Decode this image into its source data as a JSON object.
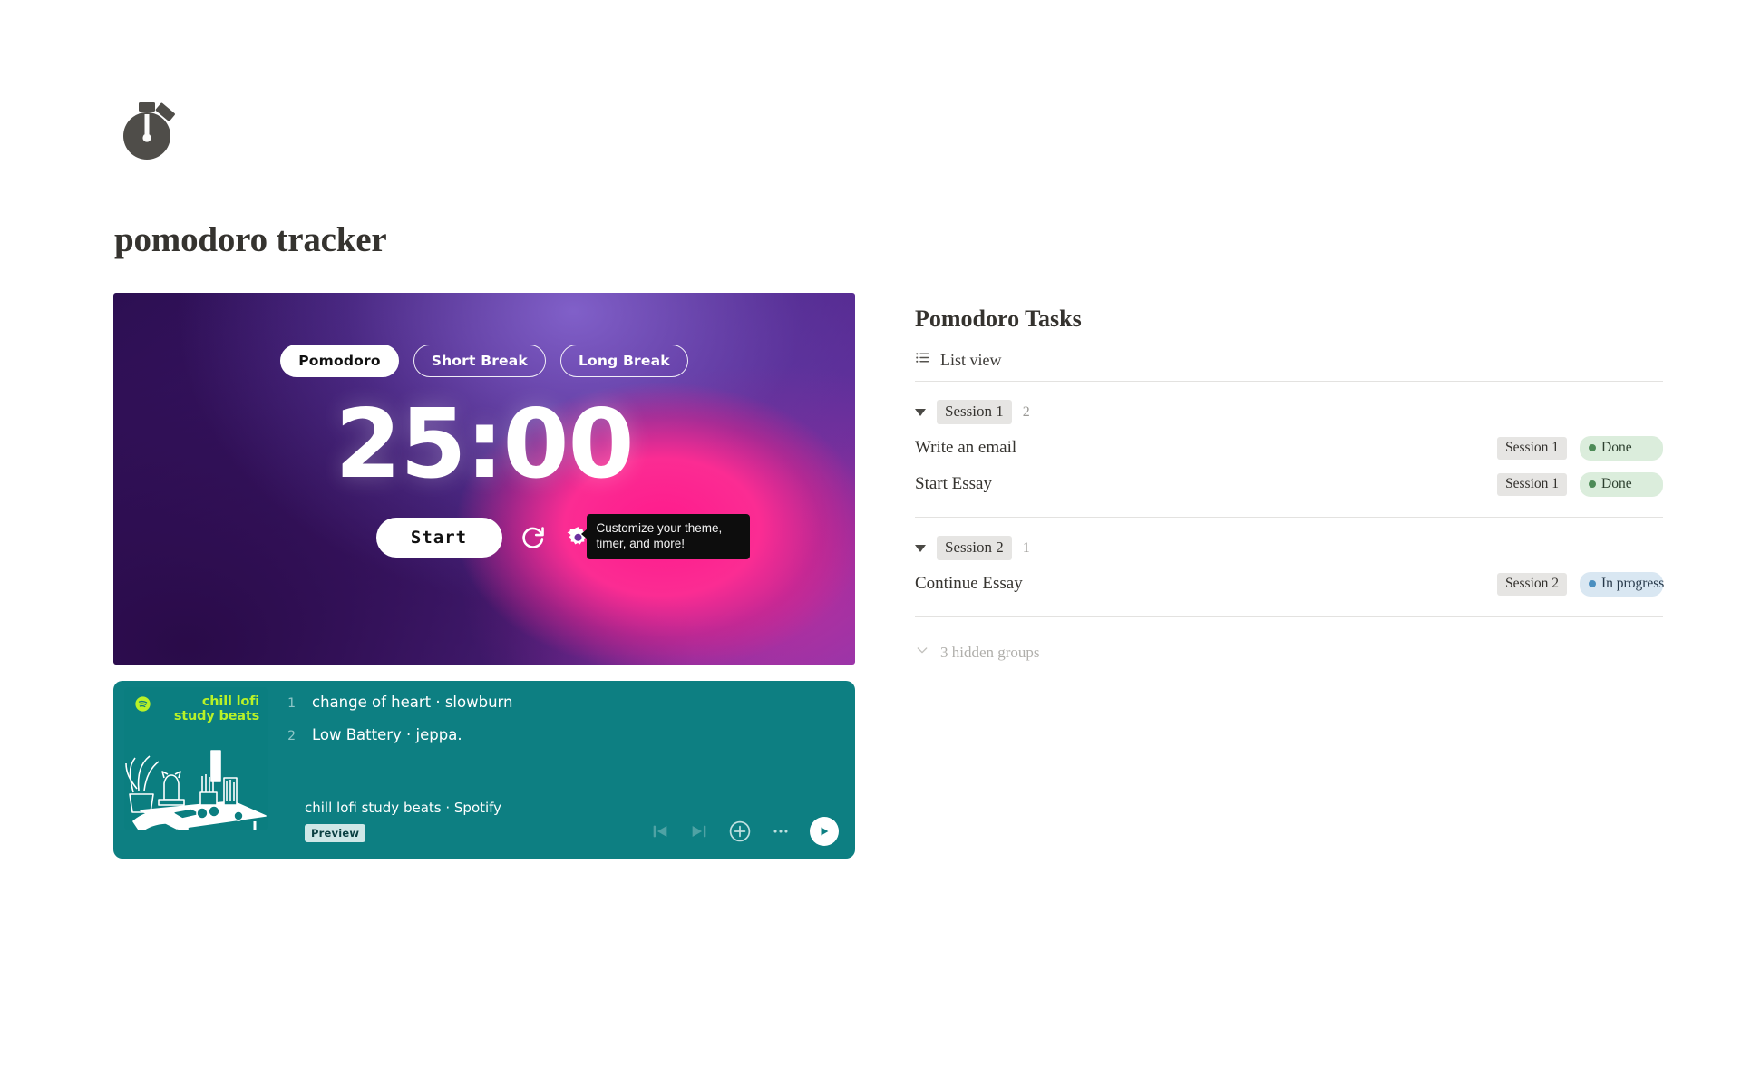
{
  "header": {
    "icon": "stopwatch-icon",
    "title": "pomodoro tracker"
  },
  "timer": {
    "tabs": [
      {
        "label": "Pomodoro",
        "active": true
      },
      {
        "label": "Short Break",
        "active": false
      },
      {
        "label": "Long Break",
        "active": false
      }
    ],
    "display": "25:00",
    "start_label": "Start",
    "reset_icon": "reset-icon",
    "settings_icon": "gear-icon",
    "tooltip": "Customize your theme, timer, and more!",
    "background_colors": {
      "deep_purple": "#2c0f52",
      "mid_purple": "#5e2a96",
      "light_purple": "#9678e6",
      "magenta": "#ff1a8c"
    }
  },
  "spotify": {
    "brand_color": "#0d7f82",
    "accent_text": "#b9f227",
    "album_title": "chill lofi\nstudy beats",
    "album_title_line1": "chill lofi",
    "album_title_line2": "study beats",
    "tracks": [
      {
        "num": "1",
        "name": "change of heart · slowburn"
      },
      {
        "num": "2",
        "name": "Low Battery · jeppa."
      }
    ],
    "playlist_line": "chill lofi study beats · Spotify",
    "preview_badge": "Preview",
    "controls": [
      {
        "name": "previous-track-button",
        "icon": "skip-back-icon"
      },
      {
        "name": "next-track-button",
        "icon": "skip-forward-icon"
      },
      {
        "name": "add-to-playlist-button",
        "icon": "plus-circle-icon"
      },
      {
        "name": "more-options-button",
        "icon": "ellipsis-icon"
      },
      {
        "name": "play-button",
        "icon": "play-icon"
      }
    ]
  },
  "tasks": {
    "title": "Pomodoro Tasks",
    "view": {
      "label": "List view",
      "icon": "list-icon"
    },
    "groups": [
      {
        "name": "Session 1",
        "count": "2",
        "items": [
          {
            "title": "Write an email",
            "tag": "Session 1",
            "status": "Done",
            "status_type": "done"
          },
          {
            "title": "Start Essay",
            "tag": "Session 1",
            "status": "Done",
            "status_type": "done"
          }
        ]
      },
      {
        "name": "Session 2",
        "count": "1",
        "items": [
          {
            "title": "Continue Essay",
            "tag": "Session 2",
            "status": "In progress",
            "status_type": "progress"
          }
        ]
      }
    ],
    "hidden_groups_label": "3 hidden groups",
    "status_colors": {
      "done_bg": "#dbeddc",
      "done_dot": "#4d8b57",
      "progress_bg": "#d9e7f2",
      "progress_dot": "#4a8fc0"
    }
  }
}
